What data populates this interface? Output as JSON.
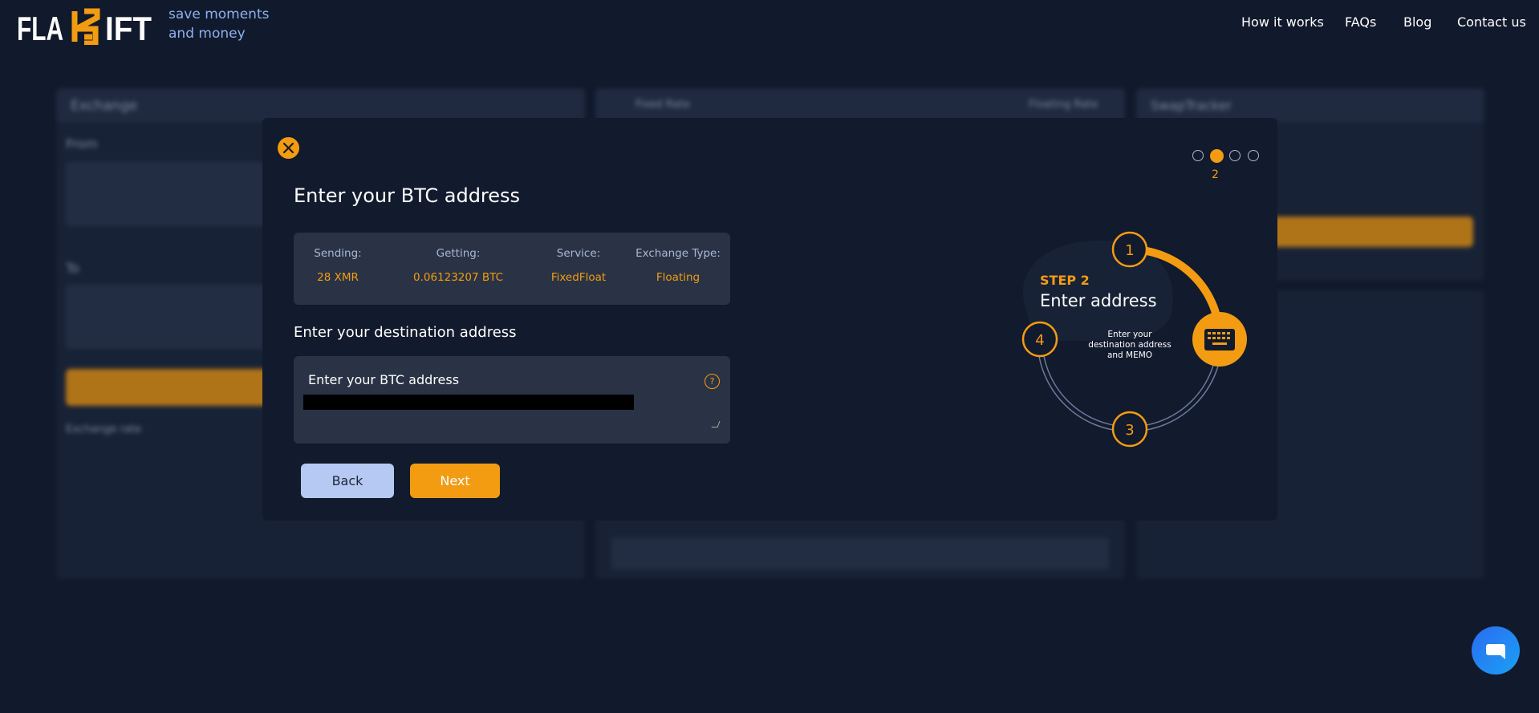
{
  "header": {
    "logo_text": "FLASHIFT",
    "tagline_line1": "save moments",
    "tagline_line2": "and money",
    "nav": [
      "How it works",
      "FAQs",
      "Blog",
      "Contact us"
    ]
  },
  "background": {
    "exchange_title": "Exchange",
    "from_label": "From",
    "to_label": "To",
    "exchange_rate_label": "Exchange rate",
    "fixed_rate": "Fixed Rate",
    "floating_rate": "Floating Rate",
    "tracker_title": "SwapTracker"
  },
  "modal": {
    "close_icon": "close-icon",
    "title": "Enter your BTC address",
    "summary": [
      {
        "label": "Sending:",
        "value": "28 XMR"
      },
      {
        "label": "Getting:",
        "value": "0.06123207 BTC"
      },
      {
        "label": "Service:",
        "value": "FixedFloat"
      },
      {
        "label": "Exchange Type:",
        "value": "Floating"
      }
    ],
    "destination_heading": "Enter your destination address",
    "address_input": {
      "label": "Enter your BTC address",
      "help": "?",
      "value_redacted": true
    },
    "back_label": "Back",
    "next_label": "Next"
  },
  "stepper": {
    "total_steps": 4,
    "current_step": 2,
    "current_step_label": "2",
    "step_title": "STEP 2",
    "step_name": "Enter address",
    "step_description_1": "Enter your",
    "step_description_2": "destination address",
    "step_description_3": "and MEMO",
    "nodes": [
      "1",
      "3",
      "4"
    ],
    "current_icon": "keyboard-icon"
  },
  "colors": {
    "accent": "#f39c12",
    "background": "#111a2c",
    "modal": "#121a2d",
    "secondary_button": "#b5c9f2",
    "chat": "#2b6cf0"
  },
  "chat_icon": "chat-bubble-icon"
}
